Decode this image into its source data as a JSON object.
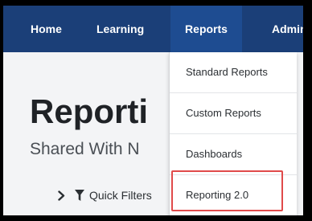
{
  "nav": {
    "items": [
      {
        "label": "Home"
      },
      {
        "label": "Learning"
      },
      {
        "label": "Reports"
      },
      {
        "label": "Admin"
      }
    ]
  },
  "page": {
    "title": "Reporti",
    "subtitle": "Shared With N"
  },
  "quick_filters": {
    "label": "Quick Filters"
  },
  "dropdown": {
    "items": [
      {
        "label": "Standard Reports"
      },
      {
        "label": "Custom Reports"
      },
      {
        "label": "Dashboards"
      },
      {
        "label": "Reporting 2.0"
      }
    ]
  },
  "colors": {
    "navbar": "#1b3f78",
    "nav_active": "#1e4c91",
    "highlight": "#e04a4a"
  },
  "icons": [
    "chevron-right-icon",
    "filter-funnel-icon"
  ]
}
